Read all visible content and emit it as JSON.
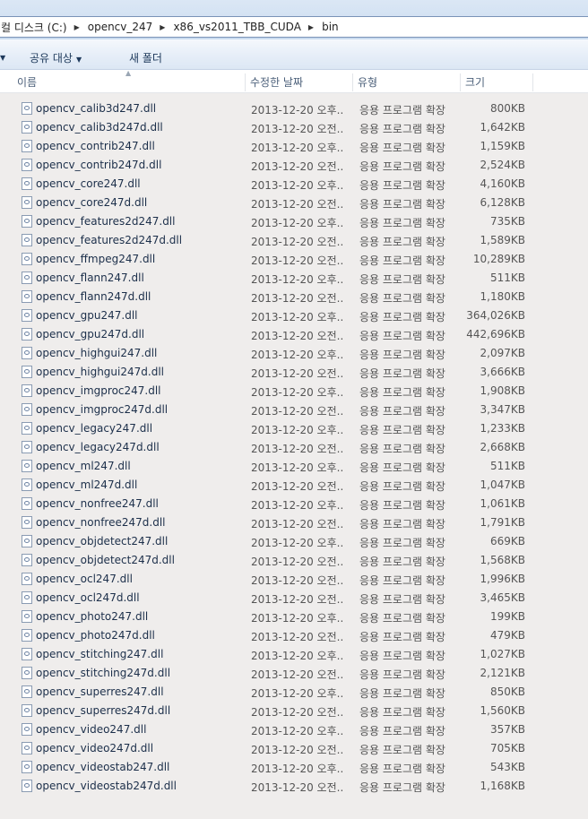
{
  "address": {
    "crumbs": [
      "컬 디스크 (C:)",
      "opencv_247",
      "x86_vs2011_TBB_CUDA",
      "bin"
    ],
    "separator": "▶"
  },
  "toolbar": {
    "organize_arrow": "▼",
    "share_label": "공유 대상",
    "share_arrow": "▼",
    "new_folder_label": "새 폴더"
  },
  "columns": {
    "name": "이름",
    "date": "수정한 날짜",
    "type": "유형",
    "size": "크기",
    "sort_glyph": "▲"
  },
  "files": [
    {
      "name": "opencv_calib3d247.dll",
      "date": "2013-12-20 오후...",
      "type": "응용 프로그램 확장",
      "size": "800KB"
    },
    {
      "name": "opencv_calib3d247d.dll",
      "date": "2013-12-20 오전...",
      "type": "응용 프로그램 확장",
      "size": "1,642KB"
    },
    {
      "name": "opencv_contrib247.dll",
      "date": "2013-12-20 오후...",
      "type": "응용 프로그램 확장",
      "size": "1,159KB"
    },
    {
      "name": "opencv_contrib247d.dll",
      "date": "2013-12-20 오전...",
      "type": "응용 프로그램 확장",
      "size": "2,524KB"
    },
    {
      "name": "opencv_core247.dll",
      "date": "2013-12-20 오후...",
      "type": "응용 프로그램 확장",
      "size": "4,160KB"
    },
    {
      "name": "opencv_core247d.dll",
      "date": "2013-12-20 오전...",
      "type": "응용 프로그램 확장",
      "size": "6,128KB"
    },
    {
      "name": "opencv_features2d247.dll",
      "date": "2013-12-20 오후...",
      "type": "응용 프로그램 확장",
      "size": "735KB"
    },
    {
      "name": "opencv_features2d247d.dll",
      "date": "2013-12-20 오전...",
      "type": "응용 프로그램 확장",
      "size": "1,589KB"
    },
    {
      "name": "opencv_ffmpeg247.dll",
      "date": "2013-12-20 오전...",
      "type": "응용 프로그램 확장",
      "size": "10,289KB"
    },
    {
      "name": "opencv_flann247.dll",
      "date": "2013-12-20 오후...",
      "type": "응용 프로그램 확장",
      "size": "511KB"
    },
    {
      "name": "opencv_flann247d.dll",
      "date": "2013-12-20 오전...",
      "type": "응용 프로그램 확장",
      "size": "1,180KB"
    },
    {
      "name": "opencv_gpu247.dll",
      "date": "2013-12-20 오후...",
      "type": "응용 프로그램 확장",
      "size": "364,026KB"
    },
    {
      "name": "opencv_gpu247d.dll",
      "date": "2013-12-20 오전...",
      "type": "응용 프로그램 확장",
      "size": "442,696KB"
    },
    {
      "name": "opencv_highgui247.dll",
      "date": "2013-12-20 오후...",
      "type": "응용 프로그램 확장",
      "size": "2,097KB"
    },
    {
      "name": "opencv_highgui247d.dll",
      "date": "2013-12-20 오전...",
      "type": "응용 프로그램 확장",
      "size": "3,666KB"
    },
    {
      "name": "opencv_imgproc247.dll",
      "date": "2013-12-20 오후...",
      "type": "응용 프로그램 확장",
      "size": "1,908KB"
    },
    {
      "name": "opencv_imgproc247d.dll",
      "date": "2013-12-20 오전...",
      "type": "응용 프로그램 확장",
      "size": "3,347KB"
    },
    {
      "name": "opencv_legacy247.dll",
      "date": "2013-12-20 오후...",
      "type": "응용 프로그램 확장",
      "size": "1,233KB"
    },
    {
      "name": "opencv_legacy247d.dll",
      "date": "2013-12-20 오전...",
      "type": "응용 프로그램 확장",
      "size": "2,668KB"
    },
    {
      "name": "opencv_ml247.dll",
      "date": "2013-12-20 오후...",
      "type": "응용 프로그램 확장",
      "size": "511KB"
    },
    {
      "name": "opencv_ml247d.dll",
      "date": "2013-12-20 오전...",
      "type": "응용 프로그램 확장",
      "size": "1,047KB"
    },
    {
      "name": "opencv_nonfree247.dll",
      "date": "2013-12-20 오후...",
      "type": "응용 프로그램 확장",
      "size": "1,061KB"
    },
    {
      "name": "opencv_nonfree247d.dll",
      "date": "2013-12-20 오전...",
      "type": "응용 프로그램 확장",
      "size": "1,791KB"
    },
    {
      "name": "opencv_objdetect247.dll",
      "date": "2013-12-20 오후...",
      "type": "응용 프로그램 확장",
      "size": "669KB"
    },
    {
      "name": "opencv_objdetect247d.dll",
      "date": "2013-12-20 오전...",
      "type": "응용 프로그램 확장",
      "size": "1,568KB"
    },
    {
      "name": "opencv_ocl247.dll",
      "date": "2013-12-20 오전...",
      "type": "응용 프로그램 확장",
      "size": "1,996KB"
    },
    {
      "name": "opencv_ocl247d.dll",
      "date": "2013-12-20 오전...",
      "type": "응용 프로그램 확장",
      "size": "3,465KB"
    },
    {
      "name": "opencv_photo247.dll",
      "date": "2013-12-20 오후...",
      "type": "응용 프로그램 확장",
      "size": "199KB"
    },
    {
      "name": "opencv_photo247d.dll",
      "date": "2013-12-20 오전...",
      "type": "응용 프로그램 확장",
      "size": "479KB"
    },
    {
      "name": "opencv_stitching247.dll",
      "date": "2013-12-20 오후...",
      "type": "응용 프로그램 확장",
      "size": "1,027KB"
    },
    {
      "name": "opencv_stitching247d.dll",
      "date": "2013-12-20 오전...",
      "type": "응용 프로그램 확장",
      "size": "2,121KB"
    },
    {
      "name": "opencv_superres247.dll",
      "date": "2013-12-20 오후...",
      "type": "응용 프로그램 확장",
      "size": "850KB"
    },
    {
      "name": "opencv_superres247d.dll",
      "date": "2013-12-20 오전...",
      "type": "응용 프로그램 확장",
      "size": "1,560KB"
    },
    {
      "name": "opencv_video247.dll",
      "date": "2013-12-20 오후...",
      "type": "응용 프로그램 확장",
      "size": "357KB"
    },
    {
      "name": "opencv_video247d.dll",
      "date": "2013-12-20 오전...",
      "type": "응용 프로그램 확장",
      "size": "705KB"
    },
    {
      "name": "opencv_videostab247.dll",
      "date": "2013-12-20 오후...",
      "type": "응용 프로그램 확장",
      "size": "543KB"
    },
    {
      "name": "opencv_videostab247d.dll",
      "date": "2013-12-20 오전...",
      "type": "응용 프로그램 확장",
      "size": "1,168KB"
    }
  ]
}
